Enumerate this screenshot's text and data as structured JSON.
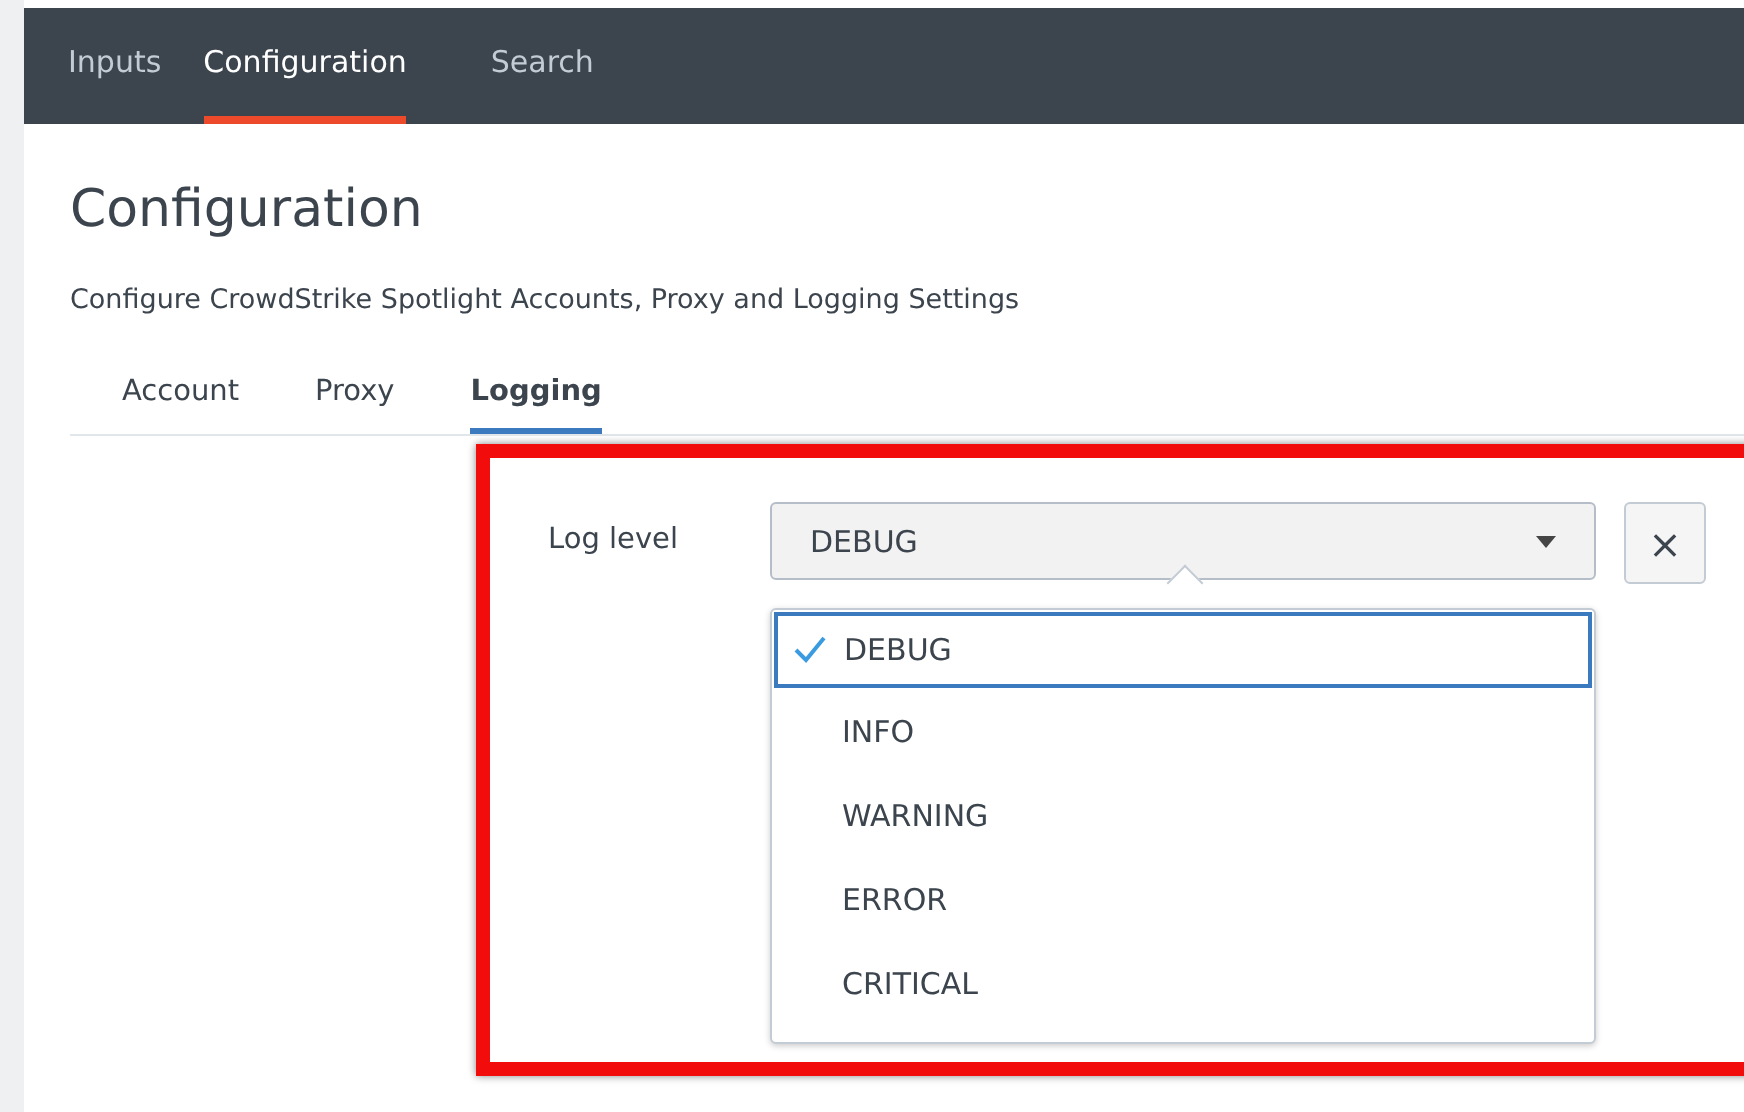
{
  "nav": [
    {
      "label": "Inputs",
      "selected": false
    },
    {
      "label": "Configuration",
      "selected": true
    },
    {
      "label": "Search",
      "selected": false
    }
  ],
  "page": {
    "title": "Configuration",
    "subtitle": "Configure CrowdStrike Spotlight Accounts, Proxy and Logging Settings"
  },
  "tabs": [
    {
      "label": "Account",
      "selected": false
    },
    {
      "label": "Proxy",
      "selected": false
    },
    {
      "label": "Logging",
      "selected": true
    }
  ],
  "log_level": {
    "label": "Log level",
    "value": "DEBUG",
    "clear_button": "×",
    "expanded": true,
    "options": [
      {
        "label": "DEBUG",
        "selected": true
      },
      {
        "label": "INFO",
        "selected": false
      },
      {
        "label": "WARNING",
        "selected": false
      },
      {
        "label": "ERROR",
        "selected": false
      },
      {
        "label": "CRITICAL",
        "selected": false
      }
    ]
  }
}
